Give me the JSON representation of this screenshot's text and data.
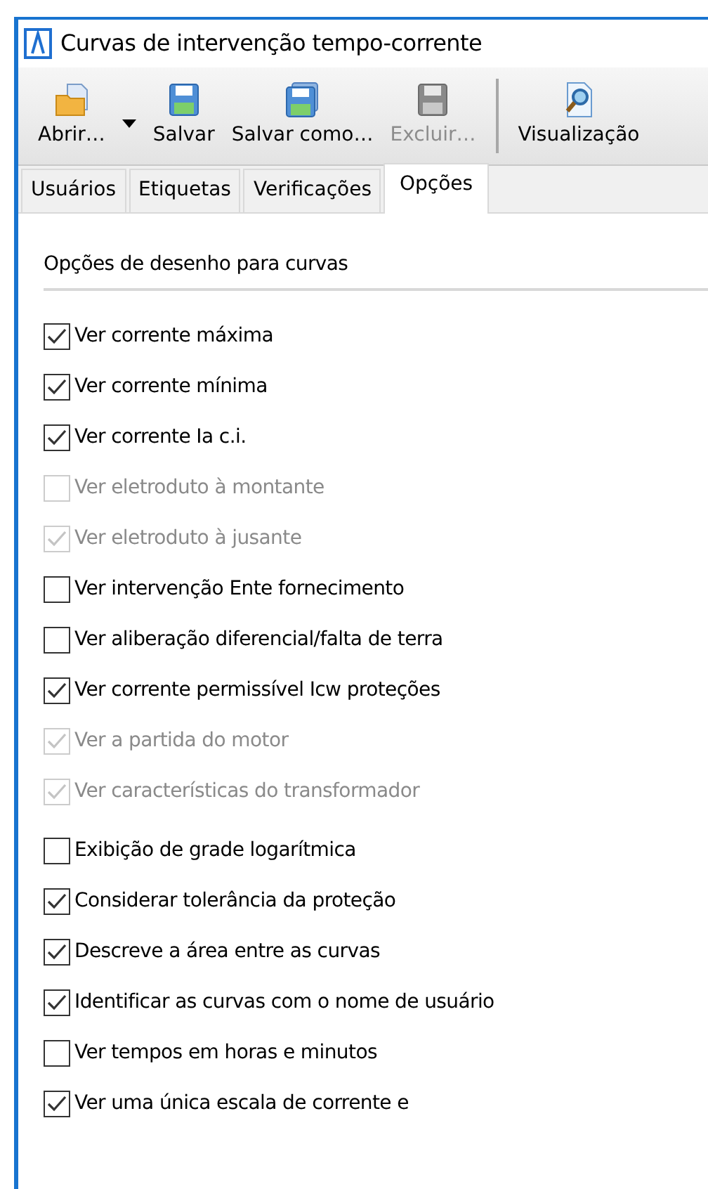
{
  "window": {
    "title": "Curvas de intervenção tempo-corrente"
  },
  "toolbar": [
    {
      "kind": "open",
      "label": "Abrir…",
      "disabled": false
    },
    {
      "kind": "dropdown",
      "disabled": false
    },
    {
      "kind": "save",
      "label": "Salvar",
      "disabled": false
    },
    {
      "kind": "save-as",
      "label": "Salvar como…",
      "disabled": false
    },
    {
      "kind": "delete",
      "label": "Excluir…",
      "disabled": true
    },
    {
      "kind": "separator"
    },
    {
      "kind": "preview",
      "label": "Visualização",
      "disabled": false
    }
  ],
  "tabs": [
    {
      "label": "Usuários",
      "selected": false
    },
    {
      "label": "Etiquetas",
      "selected": false
    },
    {
      "label": "Verificações",
      "selected": false
    },
    {
      "label": "Opções",
      "selected": true
    }
  ],
  "section": {
    "title": "Opções de desenho para curvas"
  },
  "option_groups": [
    [
      {
        "label": "Ver corrente máxima",
        "checked": true,
        "disabled": false
      },
      {
        "label": "Ver corrente mínima",
        "checked": true,
        "disabled": false
      },
      {
        "label": "Ver corrente Ia c.i.",
        "checked": true,
        "disabled": false
      },
      {
        "label": "Ver eletroduto à montante",
        "checked": false,
        "disabled": true
      },
      {
        "label": "Ver eletroduto à jusante",
        "checked": true,
        "disabled": true
      },
      {
        "label": "Ver intervenção Ente fornecimento",
        "checked": false,
        "disabled": false
      },
      {
        "label": "Ver aliberação diferencial/falta de terra",
        "checked": false,
        "disabled": false
      },
      {
        "label": "Ver corrente permissível Icw proteções",
        "checked": true,
        "disabled": false
      },
      {
        "label": "Ver a partida do motor",
        "checked": true,
        "disabled": true
      },
      {
        "label": "Ver características do transformador",
        "checked": true,
        "disabled": true
      }
    ],
    [
      {
        "label": "Exibição de grade logarítmica",
        "checked": false,
        "disabled": false
      },
      {
        "label": "Considerar tolerância da proteção",
        "checked": true,
        "disabled": false
      },
      {
        "label": "Descreve a área entre as curvas",
        "checked": true,
        "disabled": false
      },
      {
        "label": "Identificar as curvas com o nome de usuário",
        "checked": true,
        "disabled": false
      },
      {
        "label": "Ver tempos em horas e minutos",
        "checked": false,
        "disabled": false
      },
      {
        "label": "Ver uma única escala de corrente e",
        "checked": true,
        "disabled": false
      }
    ]
  ]
}
